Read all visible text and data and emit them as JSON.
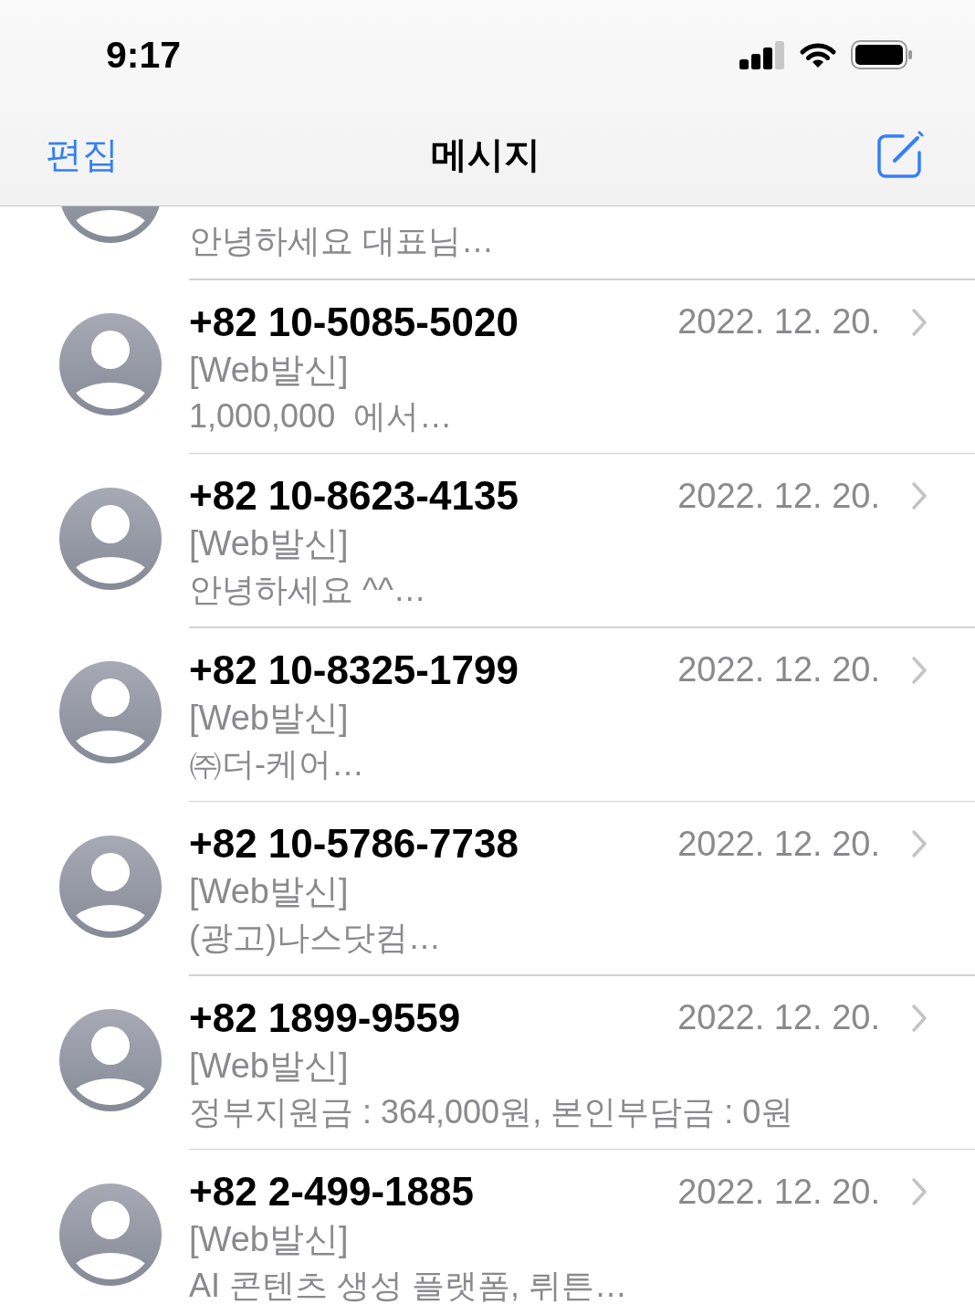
{
  "status_bar": {
    "time": "9:17"
  },
  "nav_bar": {
    "left_button": "편집",
    "title": "메시지"
  },
  "conversations": [
    {
      "kind": "clipped",
      "preview": "안녕하세요 대표님…"
    },
    {
      "kind": "full",
      "sender": "+82 10-5085-5020",
      "date": "2022. 12. 20.",
      "tag": "[Web발신]",
      "preview": "1,000,000  에서…"
    },
    {
      "kind": "full",
      "sender": "+82 10-8623-4135",
      "date": "2022. 12. 20.",
      "tag": "[Web발신]",
      "preview": "안녕하세요 ^^…"
    },
    {
      "kind": "full",
      "sender": "+82 10-8325-1799",
      "date": "2022. 12. 20.",
      "tag": "[Web발신]",
      "preview": "㈜더-케어…"
    },
    {
      "kind": "full",
      "sender": "+82 10-5786-7738",
      "date": "2022. 12. 20.",
      "tag": "[Web발신]",
      "preview": "(광고)나스닷컴…"
    },
    {
      "kind": "full",
      "sender": "+82 1899-9559",
      "date": "2022. 12. 20.",
      "tag": "[Web발신]",
      "preview": "정부지원금 : 364,000원, 본인부담금 : 0원"
    },
    {
      "kind": "full",
      "sender": "+82 2-499-1885",
      "date": "2022. 12. 20.",
      "tag": "[Web발신]",
      "preview": "AI 콘텐츠 생성 플랫폼, 뤼튼…"
    }
  ]
}
